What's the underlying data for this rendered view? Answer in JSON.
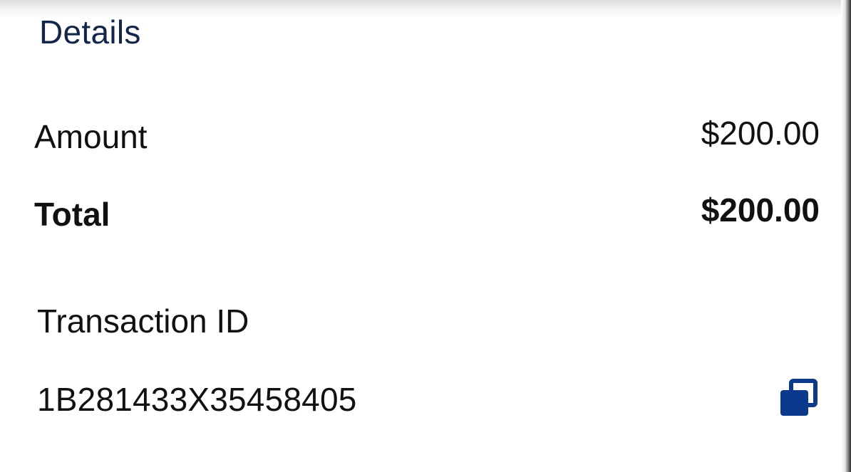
{
  "details": {
    "title": "Details",
    "amount_label": "Amount",
    "amount_value": "$200.00",
    "total_label": "Total",
    "total_value": "$200.00",
    "transaction_id_label": "Transaction ID",
    "transaction_id_value": "1B281433X35458405"
  },
  "icons": {
    "copy": "copy-icon"
  },
  "colors": {
    "title": "#14254a",
    "text": "#111111",
    "accent": "#0b3a8c"
  }
}
